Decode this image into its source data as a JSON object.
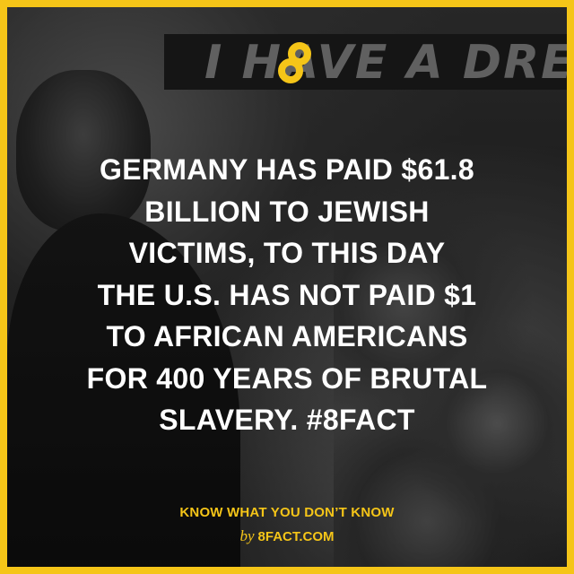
{
  "background": {
    "banner_text": "I HAVE A DREA"
  },
  "logo": {
    "icon": "8fact-logo-icon",
    "color": "#f5c518"
  },
  "main": {
    "lines": [
      "GERMANY HAS PAID $61.8",
      "BILLION TO JEWISH",
      "VICTIMS, TO THIS DAY",
      "THE U.S. HAS NOT PAID $1",
      "TO AFRICAN AMERICANS",
      "FOR 400 YEARS OF BRUTAL",
      "SLAVERY. #8FACT"
    ]
  },
  "footer": {
    "tagline": "KNOW WHAT YOU DON’T KNOW",
    "by": "by",
    "site": "8FACT.COM"
  },
  "colors": {
    "accent": "#f5c518",
    "text": "#ffffff"
  }
}
